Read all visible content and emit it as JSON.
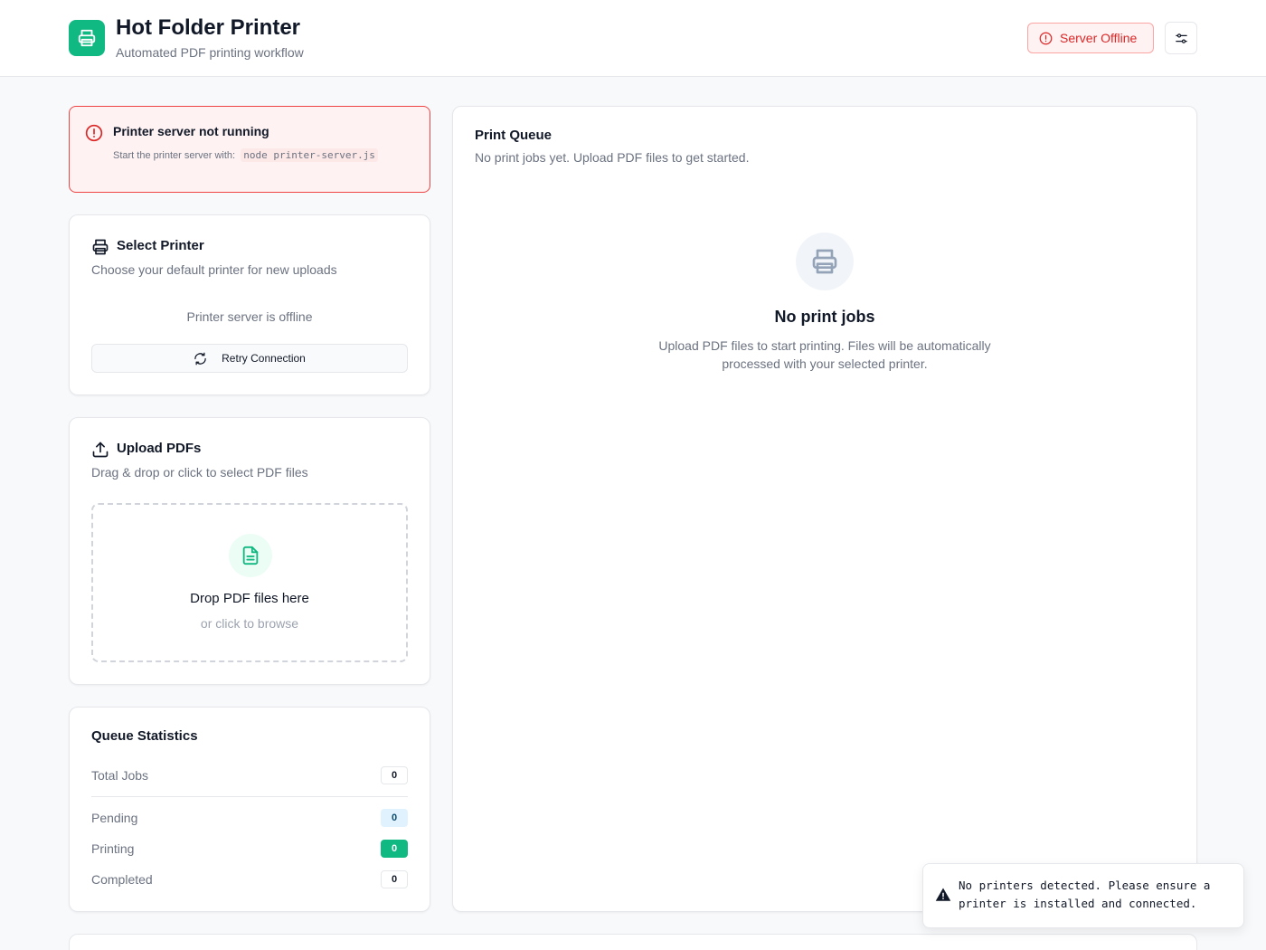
{
  "header": {
    "title": "Hot Folder Printer",
    "subtitle": "Automated PDF printing workflow",
    "logo_icon": "printer-icon",
    "status_label": "Server Offline",
    "status_color": "#dc2626",
    "settings_icon": "sliders-icon"
  },
  "alert": {
    "title": "Printer server not running",
    "body_prefix": "Start the printer server with:",
    "command": "node printer-server.js",
    "color": "#ef4444"
  },
  "select_printer": {
    "title": "Select Printer",
    "description": "Choose your default printer for new uploads",
    "offline_message": "Printer server is offline",
    "retry_label": "Retry Connection"
  },
  "upload": {
    "title": "Upload PDFs",
    "description": "Drag & drop or click to select PDF files",
    "drop_title": "Drop PDF files here",
    "drop_subtitle": "or click to browse"
  },
  "stats": {
    "title": "Queue Statistics",
    "total_label": "Total Jobs",
    "total_value": "0",
    "pending_label": "Pending",
    "pending_value": "0",
    "printing_label": "Printing",
    "printing_value": "0",
    "completed_label": "Completed",
    "completed_value": "0"
  },
  "queue": {
    "title": "Print Queue",
    "description": "No print jobs yet. Upload PDF files to get started.",
    "empty_title": "No print jobs",
    "empty_description": "Upload PDF files to start printing. Files will be automatically processed with your selected printer."
  },
  "toast": {
    "message": "No printers detected. Please ensure a printer is installed and connected."
  },
  "colors": {
    "accent": "#10b981",
    "danger": "#dc2626",
    "pending_badge": "#e0f2fe"
  }
}
